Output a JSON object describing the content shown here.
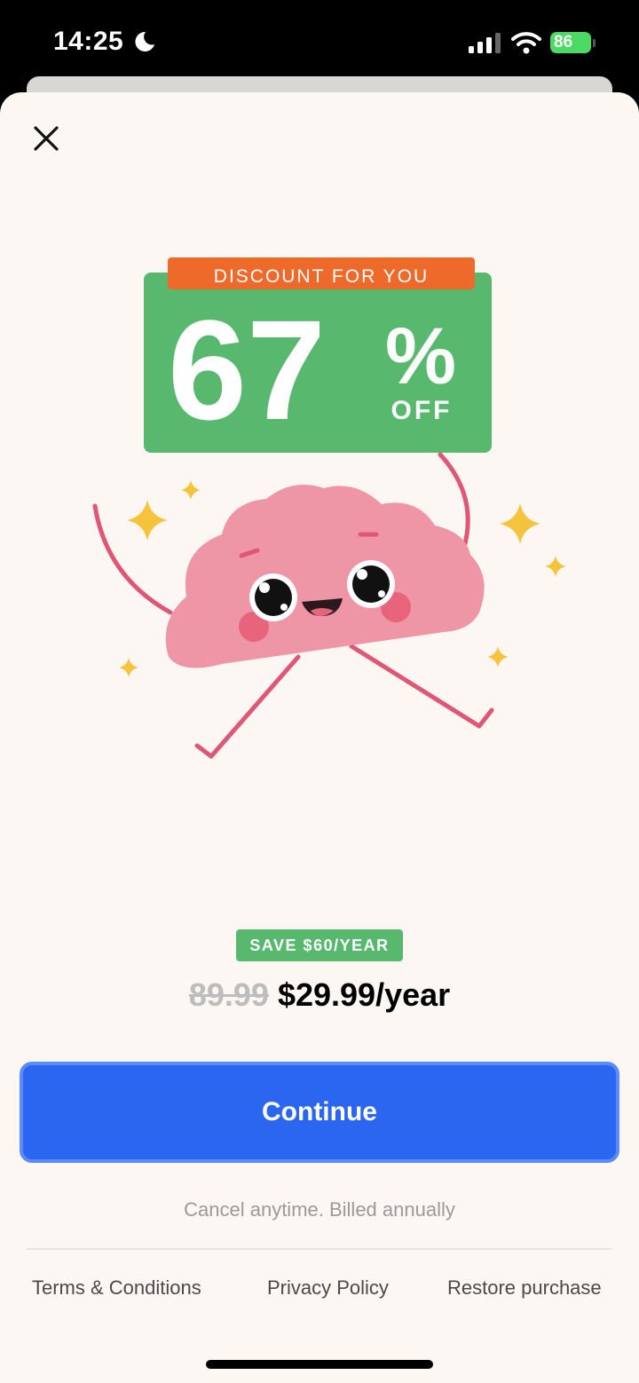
{
  "status_bar": {
    "time": "14:25",
    "battery_level": "86"
  },
  "illustration": {
    "discount_banner": "DISCOUNT FOR YOU",
    "discount_amount": "67",
    "discount_percent_symbol": "%",
    "discount_off": "OFF"
  },
  "offer": {
    "save_badge": "SAVE $60/YEAR",
    "old_price": "89.99",
    "new_price": "$29.99/year"
  },
  "actions": {
    "continue_label": "Continue"
  },
  "note": "Cancel anytime. Billed annually",
  "footer": {
    "terms": "Terms & Conditions",
    "privacy": "Privacy Policy",
    "restore": "Restore purchase"
  },
  "colors": {
    "primary_button": "#2b66f0",
    "discount_green": "#58b96e",
    "banner_orange": "#ee6a2a",
    "brain_pink": "#ee95a6",
    "background": "#fcf7f2"
  }
}
